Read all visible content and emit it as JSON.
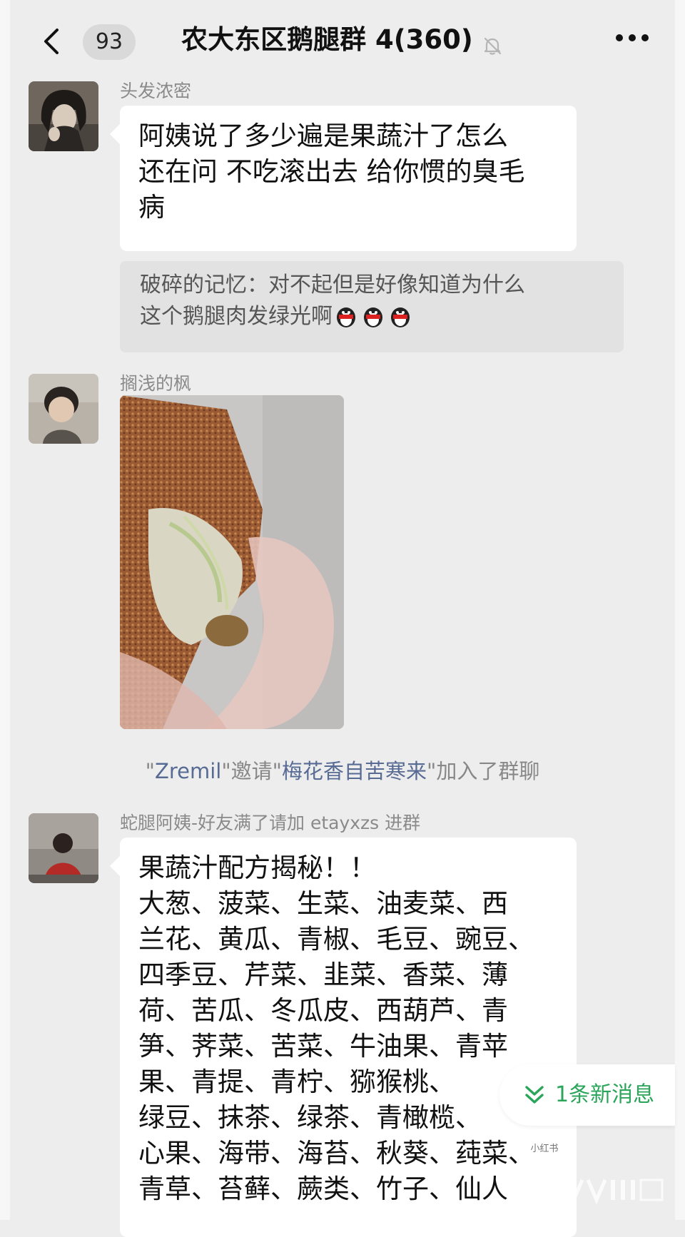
{
  "header": {
    "unread_count": "93",
    "title": "农大东区鹅腿群 4(360)"
  },
  "messages": [
    {
      "sender": "头发浓密",
      "text": "阿姨说了多少遍是果蔬汁了怎么\n还在问 不吃滚出去 给你惯的臭毛\n病",
      "quote": "破碎的记忆：对不起但是好像知道为什么\n这个鹅腿肉发绿光啊"
    },
    {
      "sender": "搁浅的枫"
    },
    {
      "sender": "蛇腿阿姨-好友满了请加 etayxzs 进群",
      "text": "果蔬汁配方揭秘！！\n大葱、菠菜、生菜、油麦菜、西\n兰花、黄瓜、青椒、毛豆、豌豆、\n四季豆、芹菜、韭菜、香菜、薄\n荷、苦瓜、冬瓜皮、西葫芦、青\n笋、荠菜、苦菜、牛油果、青苹\n果、青提、青柠、猕猴桃、\n绿豆、抹茶、绿茶、青橄榄、\n心果、海带、海苔、秋葵、莼菜、\n青草、苔藓、蕨类、竹子、仙人"
    }
  ],
  "system": {
    "q1": "\"",
    "inviter": "Zremil",
    "q2": "\"邀请\"",
    "invitee": "梅花香自苦寒来",
    "q3": "\"加入了群聊"
  },
  "new_message_pill": "1条新消息",
  "watermark": "小红书"
}
